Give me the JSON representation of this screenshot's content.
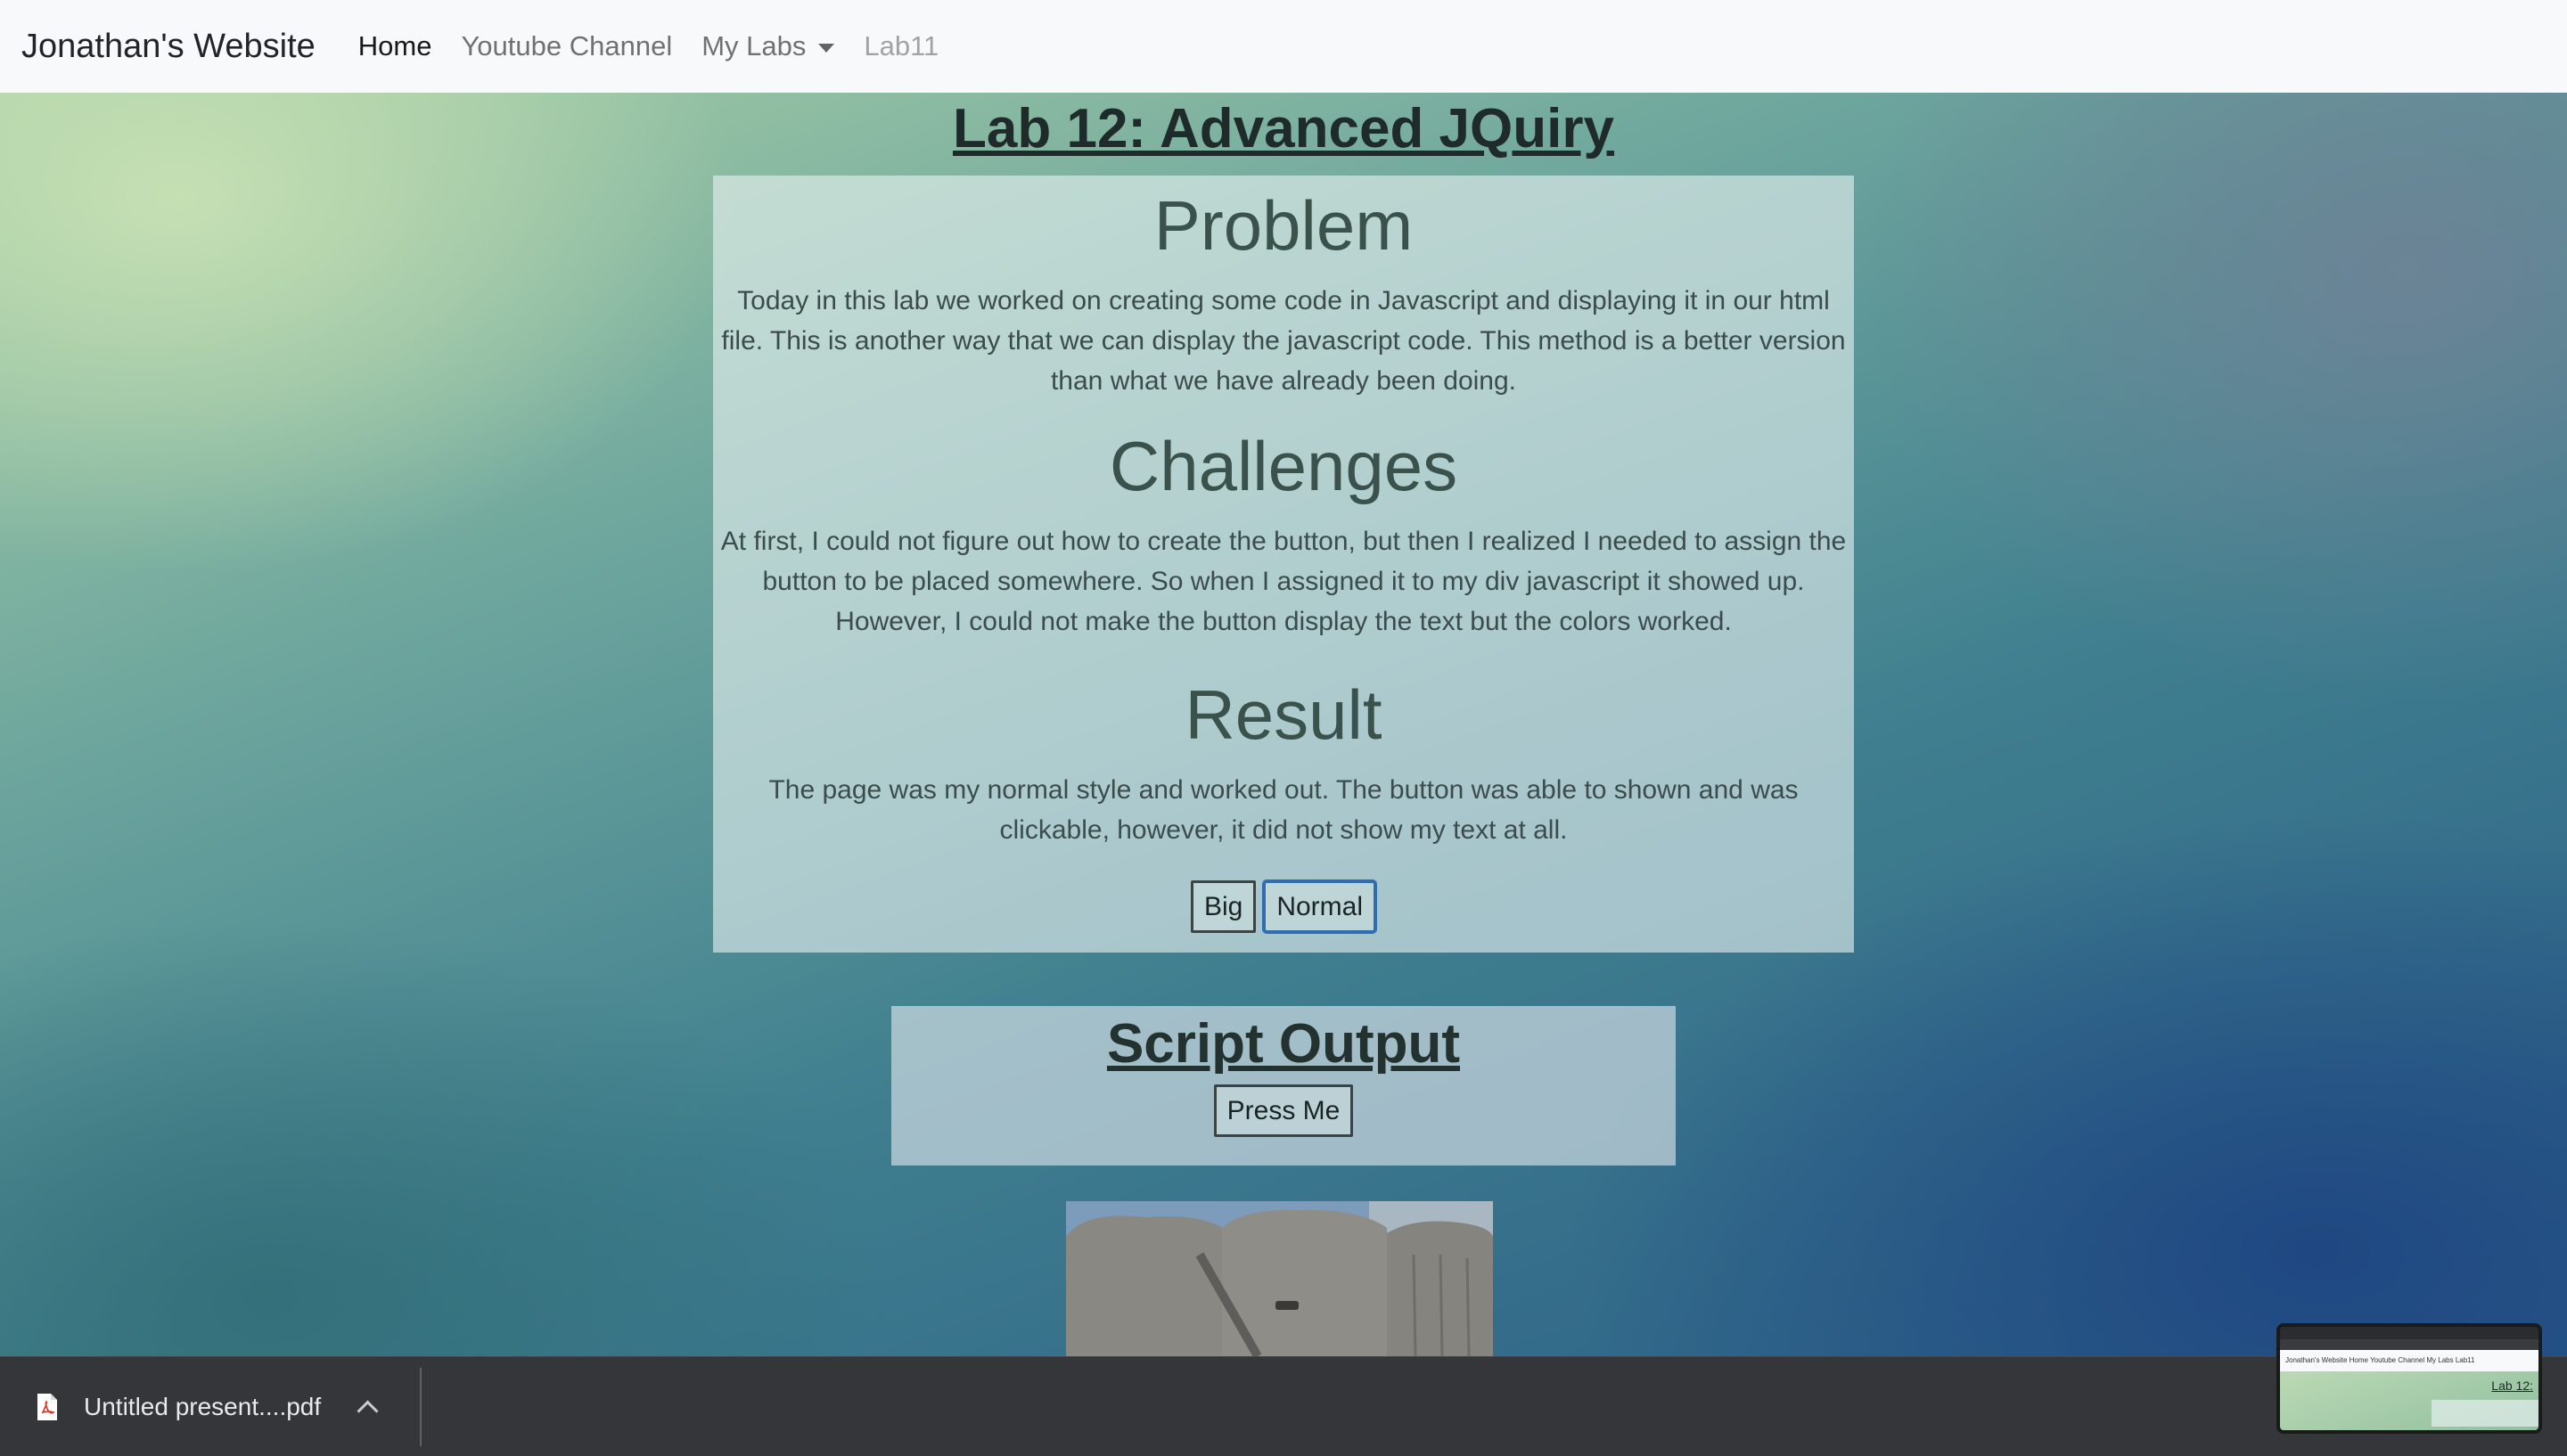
{
  "navbar": {
    "brand": "Jonathan's Website",
    "links": [
      {
        "label": "Home",
        "state": "active"
      },
      {
        "label": "Youtube Channel",
        "state": "normal"
      },
      {
        "label": "My Labs",
        "state": "dropdown"
      },
      {
        "label": "Lab11",
        "state": "disabled"
      }
    ]
  },
  "page": {
    "title": "Lab 12: Advanced JQuiry"
  },
  "sections": {
    "problem": {
      "heading": "Problem",
      "text": "Today in this lab we worked on creating some code in Javascript and displaying it in our html file. This is another way that we can display the javascript code. This method is a better version than what we have already been doing."
    },
    "challenges": {
      "heading": "Challenges",
      "text": "At first, I could not figure out how to create the button, but then I realized I needed to assign the button to be placed somewhere. So when I assigned it to my div javascript it showed up. However, I could not make the button display the text but the colors worked."
    },
    "result": {
      "heading": "Result",
      "text": "The page was my normal style and worked out. The button was able to shown and was clickable, however, it did not show my text at all."
    }
  },
  "buttons": {
    "big": "Big",
    "normal": "Normal"
  },
  "output": {
    "title": "Script Output",
    "press_button": "Press Me"
  },
  "download_bar": {
    "filename": "Untitled present....pdf",
    "icon": "pdf-file-icon"
  },
  "thumbnail": {
    "nav_text": "Jonathan's Website   Home   Youtube Channel   My Labs   Lab11",
    "title": "Lab 12:"
  },
  "colors": {
    "navbar_bg": "#f8f9fa",
    "download_bar_bg": "#35363a",
    "focus_border": "#2f6cb0"
  }
}
